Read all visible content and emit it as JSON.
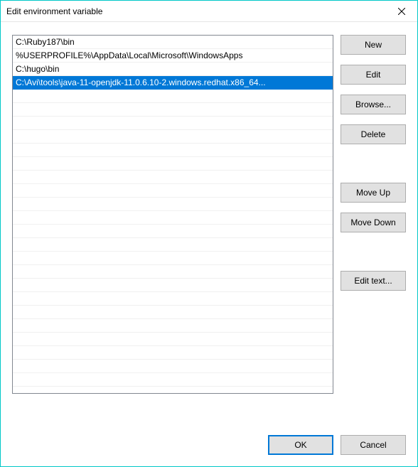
{
  "window": {
    "title": "Edit environment variable"
  },
  "paths": {
    "items": [
      {
        "value": "C:\\Ruby187\\bin",
        "selected": false
      },
      {
        "value": "%USERPROFILE%\\AppData\\Local\\Microsoft\\WindowsApps",
        "selected": false
      },
      {
        "value": "C:\\hugo\\bin",
        "selected": false
      },
      {
        "value": "C:\\Avi\\tools\\java-11-openjdk-11.0.6.10-2.windows.redhat.x86_64...",
        "selected": true
      }
    ]
  },
  "buttons": {
    "new": "New",
    "edit": "Edit",
    "browse": "Browse...",
    "delete": "Delete",
    "moveUp": "Move Up",
    "moveDown": "Move Down",
    "editText": "Edit text...",
    "ok": "OK",
    "cancel": "Cancel"
  }
}
